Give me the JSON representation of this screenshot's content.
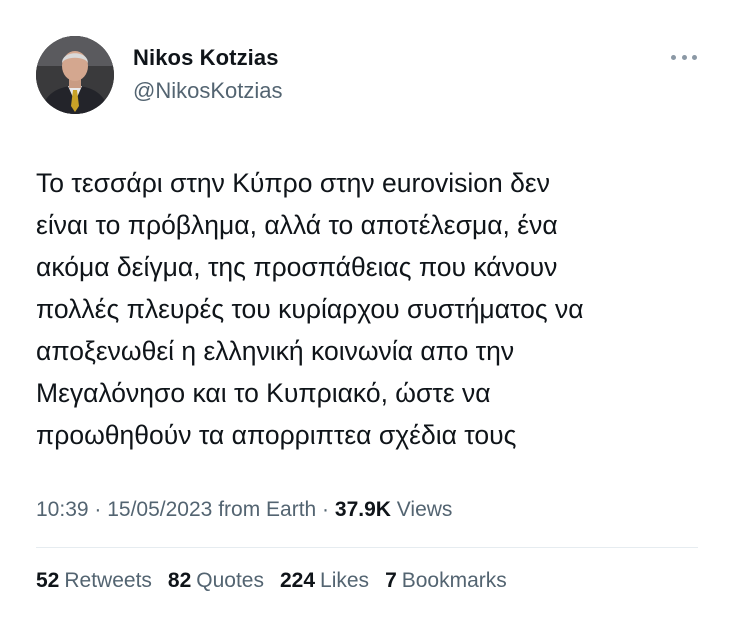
{
  "tweet": {
    "author": {
      "display_name": "Nikos Kotzias",
      "handle": "@NikosKotzias",
      "avatar_icon": "profile-photo"
    },
    "text": "Το τεσσάρι στην Κύπρο στην eurovision δεν\nείναι το πρόβλημα, αλλά το αποτέλεσμα, ένα\nακόμα δείγμα, της προσπάθειας που κάνουν\nπολλές πλευρές του κυρίαρχου συστήματος να\nαποξενωθεί η ελληνική κοινωνία απο την\nΜεγαλόνησο και το Κυπριακό, ώστε να\nπροωθηθούν τα απορριπτεα σχέδια τους",
    "meta": {
      "time": "10:39",
      "separator": " · ",
      "date": "15/05/2023",
      "source": "from Earth",
      "views_count": "37.9K",
      "views_label": "Views"
    },
    "stats": {
      "retweets_count": "52",
      "retweets_label": "Retweets",
      "quotes_count": "82",
      "quotes_label": "Quotes",
      "likes_count": "224",
      "likes_label": "Likes",
      "bookmarks_count": "7",
      "bookmarks_label": "Bookmarks"
    }
  },
  "colors": {
    "text_primary": "#0f1419",
    "text_secondary": "#536471",
    "divider": "#e6ecf0",
    "more_dots": "#8b98a5"
  }
}
